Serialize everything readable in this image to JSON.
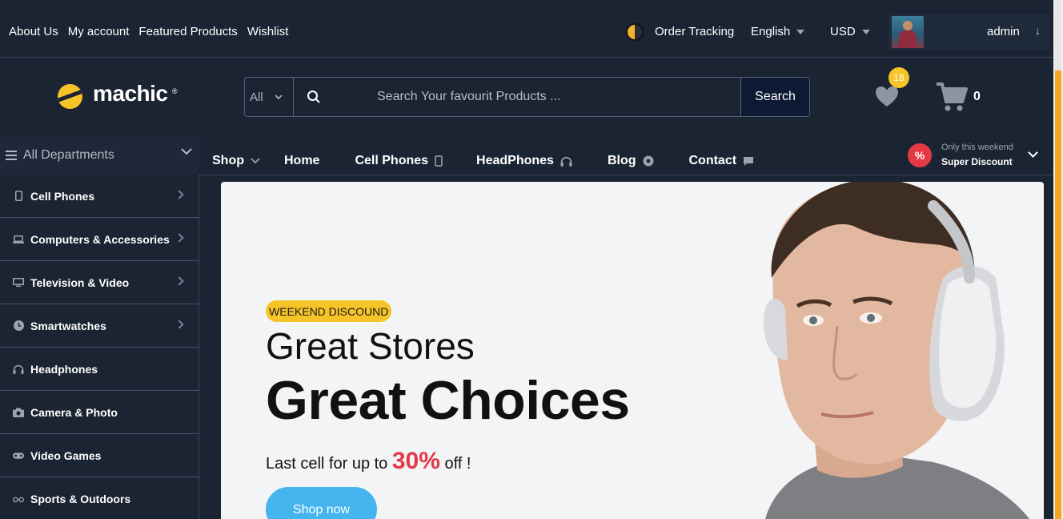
{
  "topbar": {
    "links": [
      "About Us",
      "My account",
      "Featured Products",
      "Wishlist"
    ],
    "order_tracking": "Order Tracking",
    "language": "English",
    "currency": "USD",
    "user": "admin"
  },
  "header": {
    "logo": "machic",
    "logo_mark": "®",
    "search_category": "All",
    "search_placeholder": "Search Your favourit Products ...",
    "search_button": "Search",
    "wishlist_count": "18",
    "cart_count": "0"
  },
  "departments": {
    "title": "All Departments",
    "items": [
      {
        "label": "Cell Phones",
        "icon": "phone-icon"
      },
      {
        "label": "Computers & Accessories",
        "icon": "laptop-icon"
      },
      {
        "label": "Television & Video",
        "icon": "tv-icon"
      },
      {
        "label": "Smartwatches",
        "icon": "clock-icon"
      },
      {
        "label": "Headphones",
        "icon": "headphones-icon"
      },
      {
        "label": "Camera & Photo",
        "icon": "camera-icon"
      },
      {
        "label": "Video Games",
        "icon": "gamepad-icon"
      },
      {
        "label": "Sports & Outdoors",
        "icon": "glasses-icon"
      }
    ]
  },
  "nav": {
    "items": [
      "Shop",
      "Home",
      "Cell Phones",
      "HeadPhones",
      "Blog",
      "Contact"
    ],
    "promo_small": "Only this weekend",
    "promo_big": "Super Discount",
    "promo_symbol": "%"
  },
  "hero": {
    "badge": "WEEKEND DISCOUND",
    "title_line1": "Great Stores",
    "title_line2": "Great Choices",
    "sub_before": "Last cell for up to ",
    "sub_percent": "30%",
    "sub_after": " off !",
    "button": "Shop now"
  },
  "colors": {
    "background": "#1b2433",
    "accent_yellow": "#f6c428",
    "accent_red": "#e53946",
    "button_blue": "#45b5f0"
  }
}
